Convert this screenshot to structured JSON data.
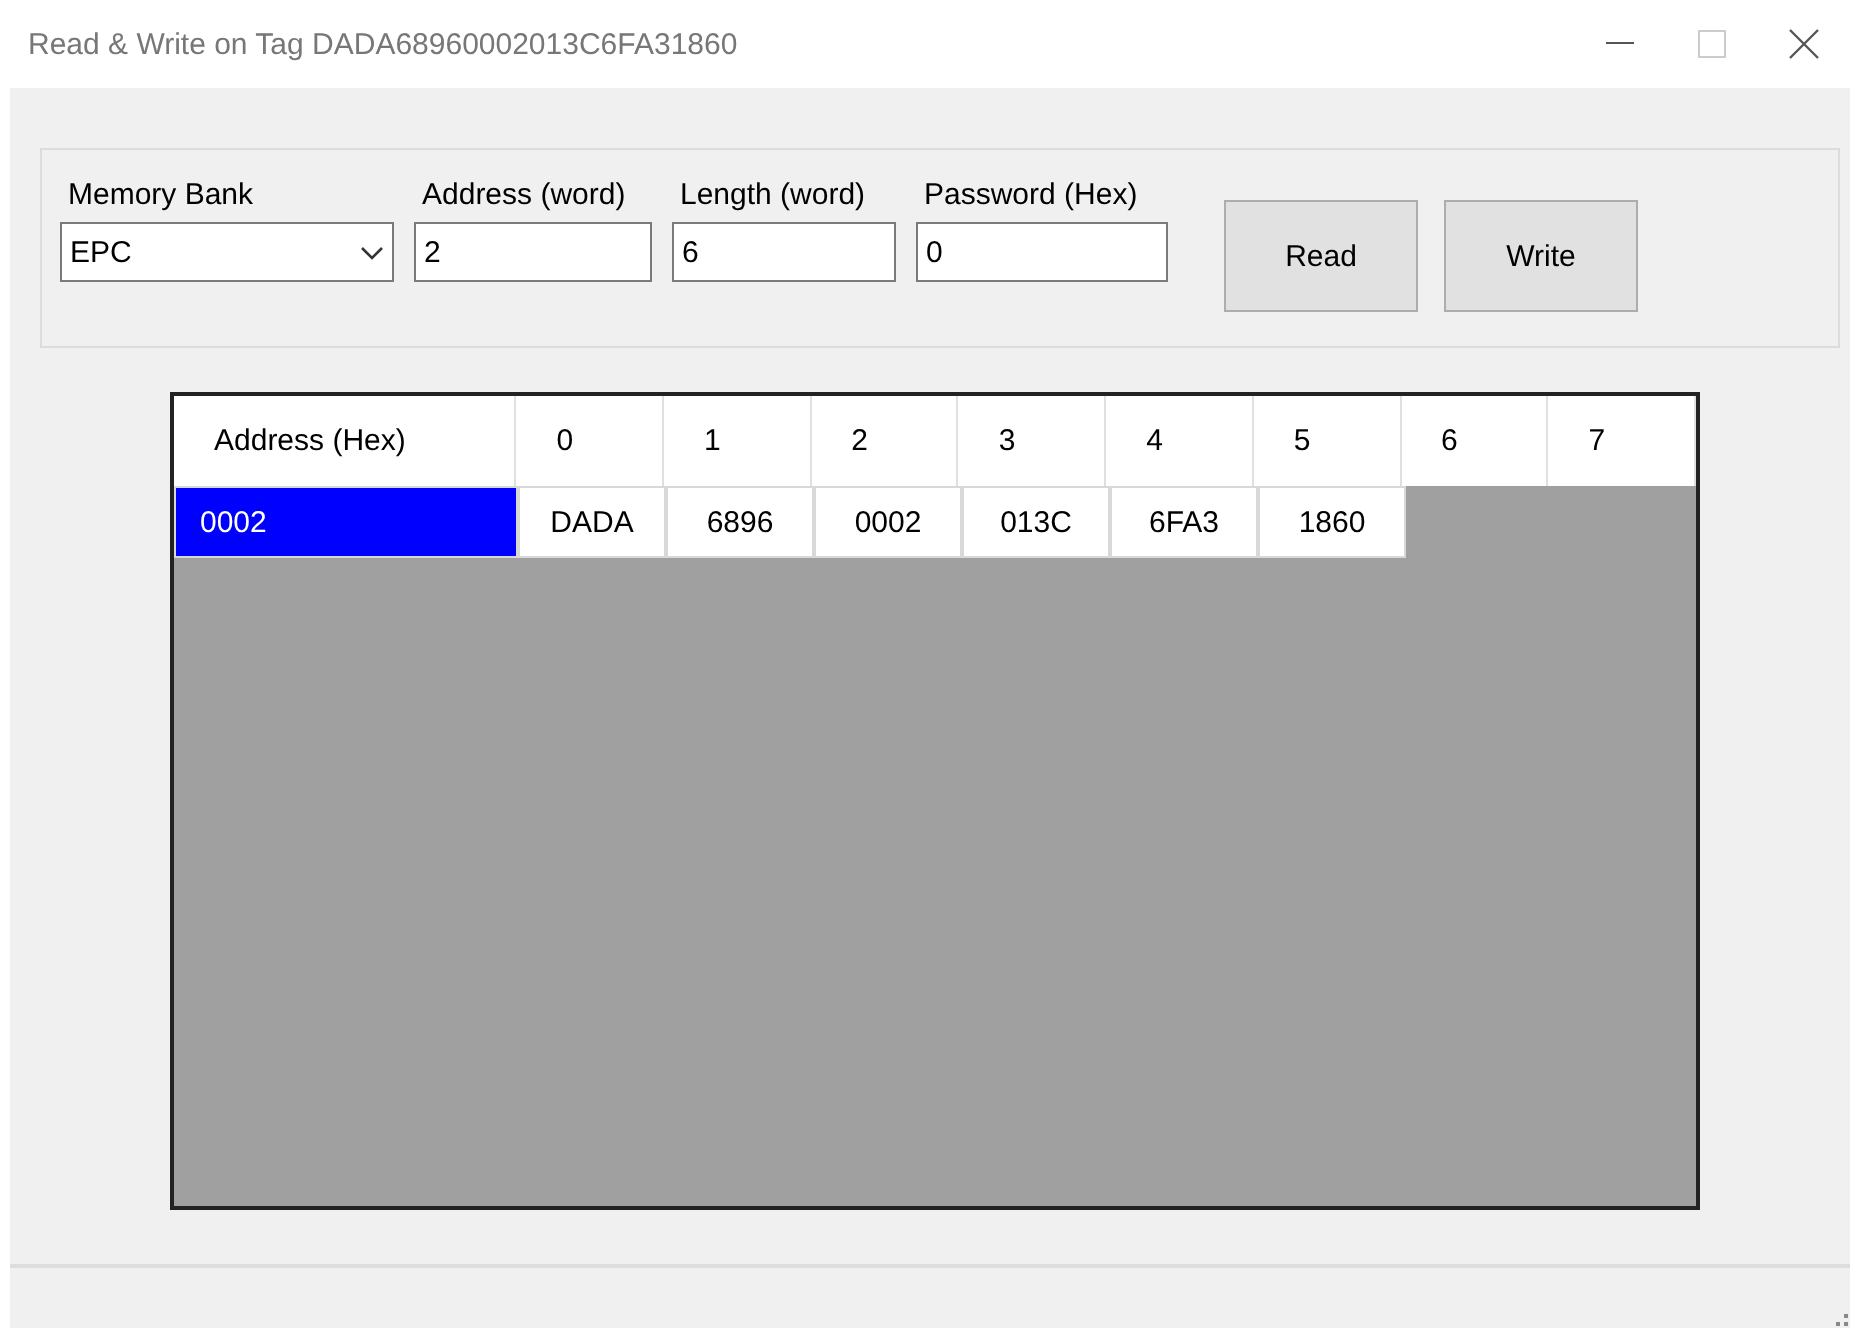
{
  "window": {
    "title": "Read & Write on Tag DADA68960002013C6FA31860"
  },
  "fields": [
    {
      "kind": "dropdown",
      "label": "Memory Bank",
      "value": "EPC"
    },
    {
      "kind": "text",
      "label": "Address (word)",
      "value": "2"
    },
    {
      "kind": "text",
      "label": "Length (word)",
      "value": "6"
    },
    {
      "kind": "text",
      "label": "Password (Hex)",
      "value": "0"
    }
  ],
  "buttons": [
    "Read",
    "Write"
  ],
  "table": {
    "columns": [
      "Address (Hex)",
      "0",
      "1",
      "2",
      "3",
      "4",
      "5",
      "6",
      "7"
    ],
    "rows": [
      {
        "selected": true,
        "cells": [
          "0002",
          "DADA",
          "6896",
          "0002",
          "013C",
          "6FA3",
          "1860"
        ]
      }
    ]
  }
}
